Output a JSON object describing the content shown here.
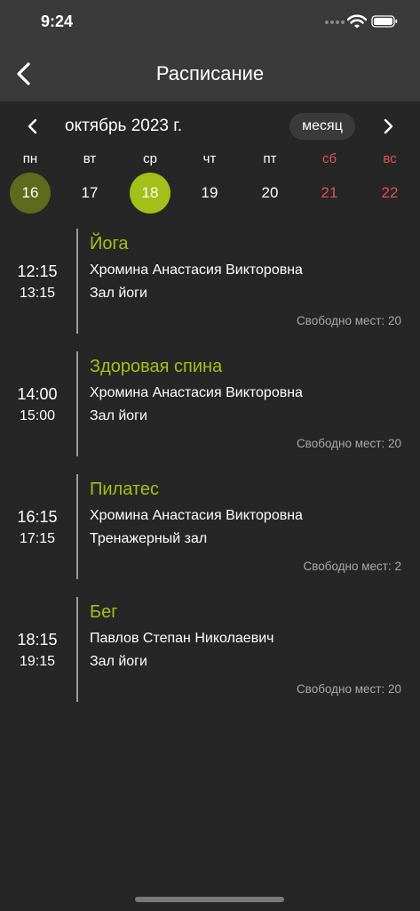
{
  "status": {
    "time": "9:24"
  },
  "header": {
    "title": "Расписание"
  },
  "calendar": {
    "month_label": "октябрь 2023 г.",
    "view_toggle": "месяц",
    "weekdays": [
      "пн",
      "вт",
      "ср",
      "чт",
      "пт",
      "сб",
      "вс"
    ],
    "dates": [
      "16",
      "17",
      "18",
      "19",
      "20",
      "21",
      "22"
    ],
    "today_index": 0,
    "selected_index": 2,
    "weekend_color": "#e0524f"
  },
  "colors": {
    "accent": "#a3bf1a",
    "today": "#5e6a1c",
    "background": "#262626",
    "header": "#3a3a3a"
  },
  "events": [
    {
      "start": "12:15",
      "end": "13:15",
      "title": "Йога",
      "trainer": "Хромина Анастасия Викторовна",
      "room": "Зал йоги",
      "seats": "Свободно мест: 20"
    },
    {
      "start": "14:00",
      "end": "15:00",
      "title": "Здоровая спина",
      "trainer": "Хромина Анастасия Викторовна",
      "room": "Зал йоги",
      "seats": "Свободно мест: 20"
    },
    {
      "start": "16:15",
      "end": "17:15",
      "title": "Пилатес",
      "trainer": "Хромина Анастасия Викторовна",
      "room": "Тренажерный зал",
      "seats": "Свободно мест: 2"
    },
    {
      "start": "18:15",
      "end": "19:15",
      "title": "Бег",
      "trainer": "Павлов Степан Николаевич",
      "room": "Зал йоги",
      "seats": "Свободно мест: 20"
    }
  ]
}
